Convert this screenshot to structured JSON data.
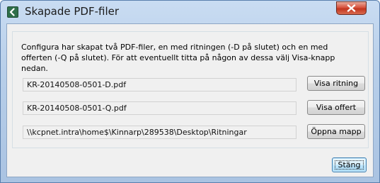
{
  "window": {
    "title": "Skapade PDF-filer",
    "app_icon": "back-arrow-icon",
    "close_icon": "close-icon"
  },
  "info": {
    "text": "Configura har skapat två PDF-filer, en med ritningen (-D på slutet) och en med offerten (-Q på slutet). För att eventuellt titta på någon av dessa välj Visa-knapp nedan."
  },
  "files": [
    {
      "value": "KR-20140508-0501-D.pdf",
      "button_label": "Visa ritning"
    },
    {
      "value": "KR-20140508-0501-Q.pdf",
      "button_label": "Visa offert"
    },
    {
      "value": "\\\\kcpnet.intra\\home$\\Kinnarp\\289538\\Desktop\\Ritningar",
      "button_label": "Öppna mapp"
    }
  ],
  "footer": {
    "close_label": "Stäng"
  },
  "colors": {
    "title_gradient_top": "#c9dcf2",
    "close_button_red": "#c2351f",
    "default_button_blue": "#3c7fb1"
  }
}
